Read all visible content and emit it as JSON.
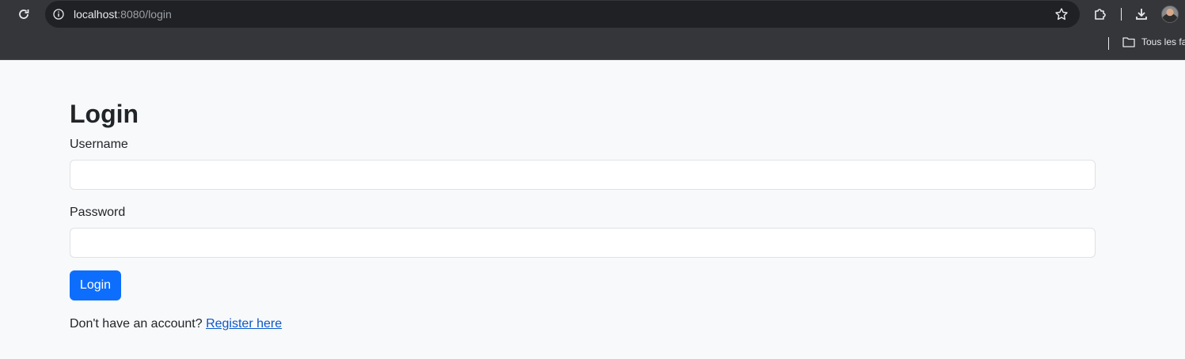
{
  "browser": {
    "url_host": "localhost",
    "url_path": ":8080/login",
    "bookmark_folder": "Tous les fa"
  },
  "page": {
    "title": "Login",
    "username_label": "Username",
    "username_value": "",
    "password_label": "Password",
    "password_value": "",
    "login_button": "Login",
    "no_account_text": "Don't have an account? ",
    "register_link": "Register here"
  },
  "colors": {
    "primary": "#0d6efd",
    "link": "#0a58ca",
    "background": "#f8f9fa",
    "chrome": "#35363a"
  },
  "icons": {
    "reload": "reload-icon",
    "site_info": "info-icon",
    "bookmark_star": "star-icon",
    "extensions": "puzzle-icon",
    "downloads": "download-icon",
    "profile": "avatar",
    "folder": "folder-icon"
  }
}
